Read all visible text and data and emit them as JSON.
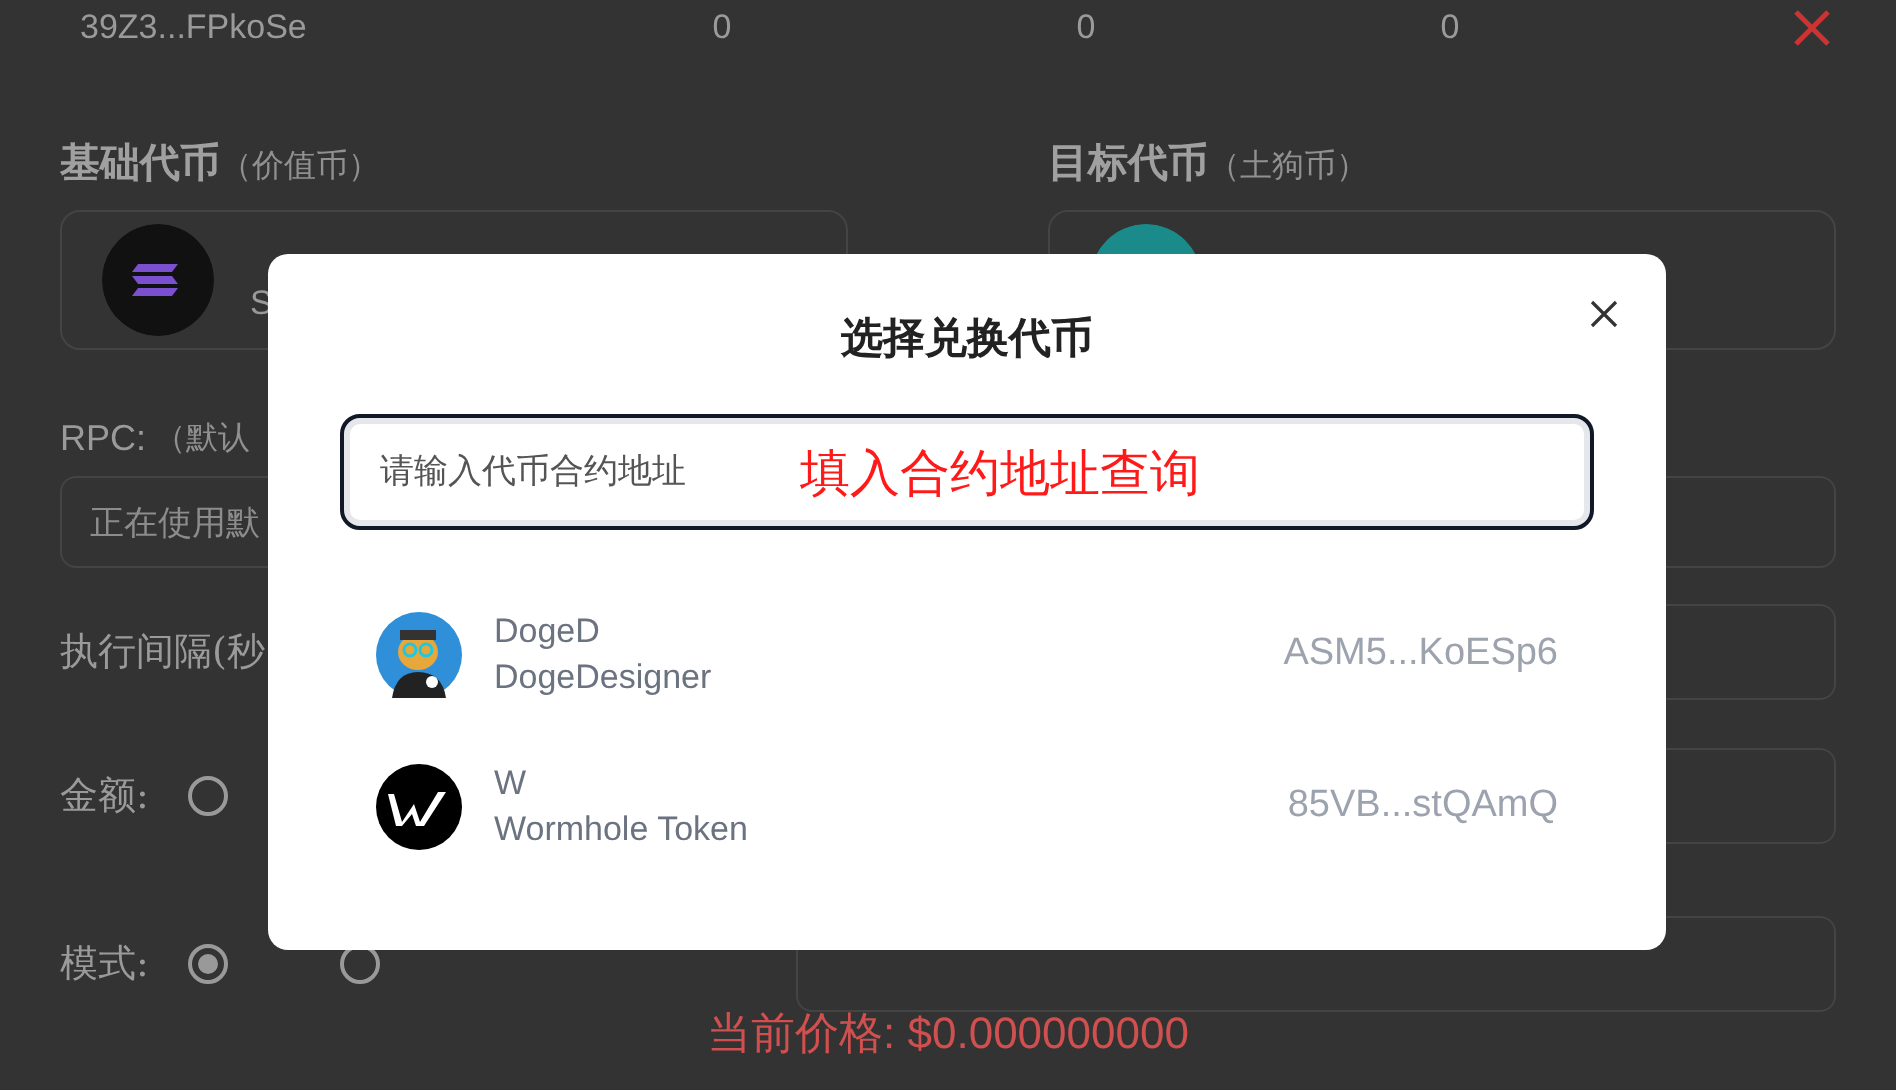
{
  "background": {
    "wallet_row": {
      "address": "39Z3...FPkoSe",
      "values": [
        "0",
        "0",
        "0"
      ]
    },
    "base_token": {
      "label": "基础代币",
      "note": "（价值币）",
      "name": "S"
    },
    "target_token": {
      "label": "目标代币",
      "note": "（土狗币）"
    },
    "rpc": {
      "label": "RPC:",
      "note": "（默认",
      "value": "正在使用默"
    },
    "interval": {
      "label": "执行间隔(秒"
    },
    "amount": {
      "label": "金额:",
      "options": [
        {
          "selected": false
        }
      ]
    },
    "mode": {
      "label": "模式:",
      "options": [
        {
          "selected": true
        },
        {
          "selected": false
        }
      ]
    },
    "current_price": "当前价格: $0.000000000"
  },
  "dialog": {
    "title": "选择兑换代币",
    "search": {
      "placeholder": "请输入代币合约地址"
    },
    "annotation": "填入合约地址查询",
    "tokens": [
      {
        "kind": "doge",
        "symbol": "DogeD",
        "name": "DogeDesigner",
        "address": "ASM5...KoESp6"
      },
      {
        "kind": "wormhole",
        "symbol": "W",
        "name": "Wormhole Token",
        "address": "85VB...stQAmQ"
      }
    ]
  }
}
